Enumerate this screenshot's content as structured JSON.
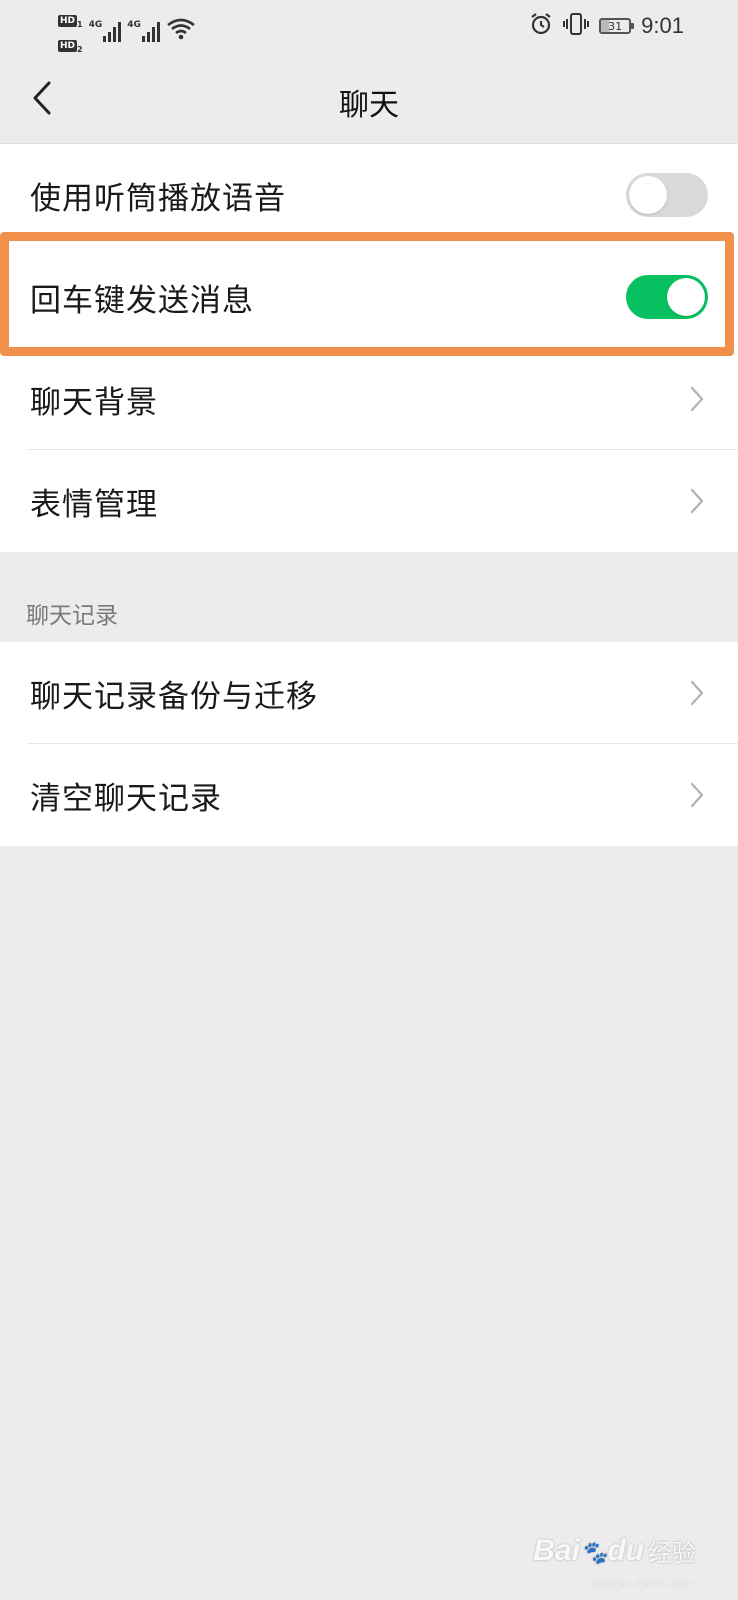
{
  "status_bar": {
    "hd1": "HD",
    "hd1_sub": "1",
    "hd2": "HD",
    "hd2_sub": "2",
    "net1": "4G",
    "net2": "4G",
    "battery": "31",
    "time": "9:01"
  },
  "nav": {
    "title": "聊天"
  },
  "settings": {
    "group1": [
      {
        "label": "使用听筒播放语音",
        "type": "toggle",
        "on": false
      },
      {
        "label": "回车键发送消息",
        "type": "toggle",
        "on": true
      },
      {
        "label": "聊天背景",
        "type": "link"
      },
      {
        "label": "表情管理",
        "type": "link"
      }
    ],
    "section2_header": "聊天记录",
    "group2": [
      {
        "label": "聊天记录备份与迁移",
        "type": "link"
      },
      {
        "label": "清空聊天记录",
        "type": "link"
      }
    ]
  },
  "colors": {
    "toggle_on": "#07c160",
    "toggle_off": "#d9d9d9",
    "highlight": "#f0904a",
    "background": "#ececec"
  },
  "watermark": {
    "brand": "Bai",
    "brand2": "du",
    "cn": "经验",
    "url": "jingyan.baidu.com"
  }
}
